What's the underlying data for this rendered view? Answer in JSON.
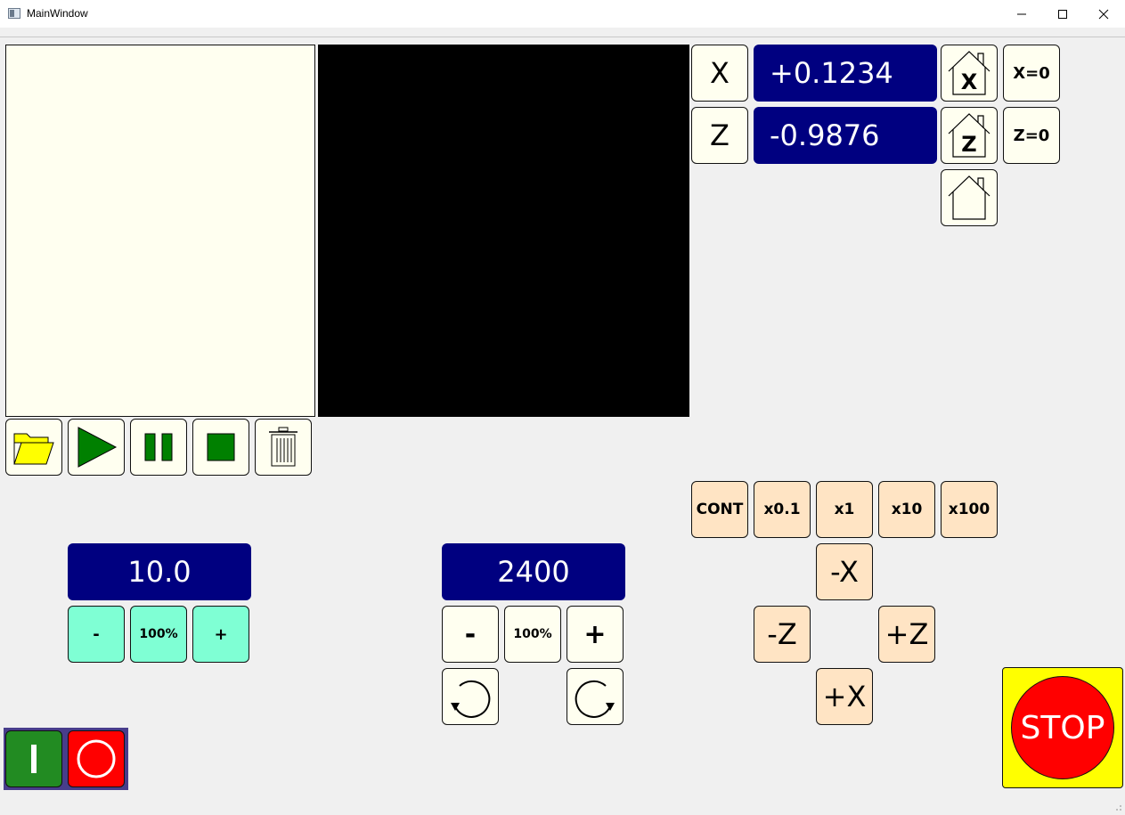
{
  "window": {
    "title": "MainWindow"
  },
  "icons": {
    "app": "app-window-icon",
    "minimize": "minimize-icon",
    "maximize": "maximize-icon",
    "close": "close-icon",
    "open": "folder-open-icon",
    "run": "play-icon",
    "pause": "pause-icon",
    "stop": "stop-square-icon",
    "clear": "trash-icon",
    "home": "home-icon",
    "ccw": "rotate-ccw-icon",
    "cw": "rotate-cw-icon",
    "power_on": "power-on-icon",
    "power_off": "power-off-icon"
  },
  "colors": {
    "dro_bg": "#000080",
    "button_bg": "#fffff0",
    "feed_bg": "#7fffd4",
    "jog_bg": "#ffe4c4",
    "estop_bg": "#ffff00",
    "stop_red": "#ff0000",
    "power_on_green": "#228b22",
    "gcode_bg": "#fffff0",
    "preview_bg": "#000000"
  },
  "axes": [
    {
      "label": "X",
      "value": "+0.1234",
      "home_letter": "X",
      "zero_label": "X=0"
    },
    {
      "label": "Z",
      "value": "-0.9876",
      "home_letter": "Z",
      "zero_label": "Z=0"
    }
  ],
  "feed": {
    "value": "10.0",
    "minus": "-",
    "reset": "100%",
    "plus": "+"
  },
  "spindle": {
    "value": "2400",
    "minus": "-",
    "reset": "100%",
    "plus": "+"
  },
  "jog": {
    "steps": [
      "CONT",
      "x0.1",
      "x1",
      "x10",
      "x100"
    ],
    "minus_x": "-X",
    "minus_z": "-Z",
    "plus_z": "+Z",
    "plus_x": "+X"
  },
  "estop": {
    "label": "STOP"
  }
}
